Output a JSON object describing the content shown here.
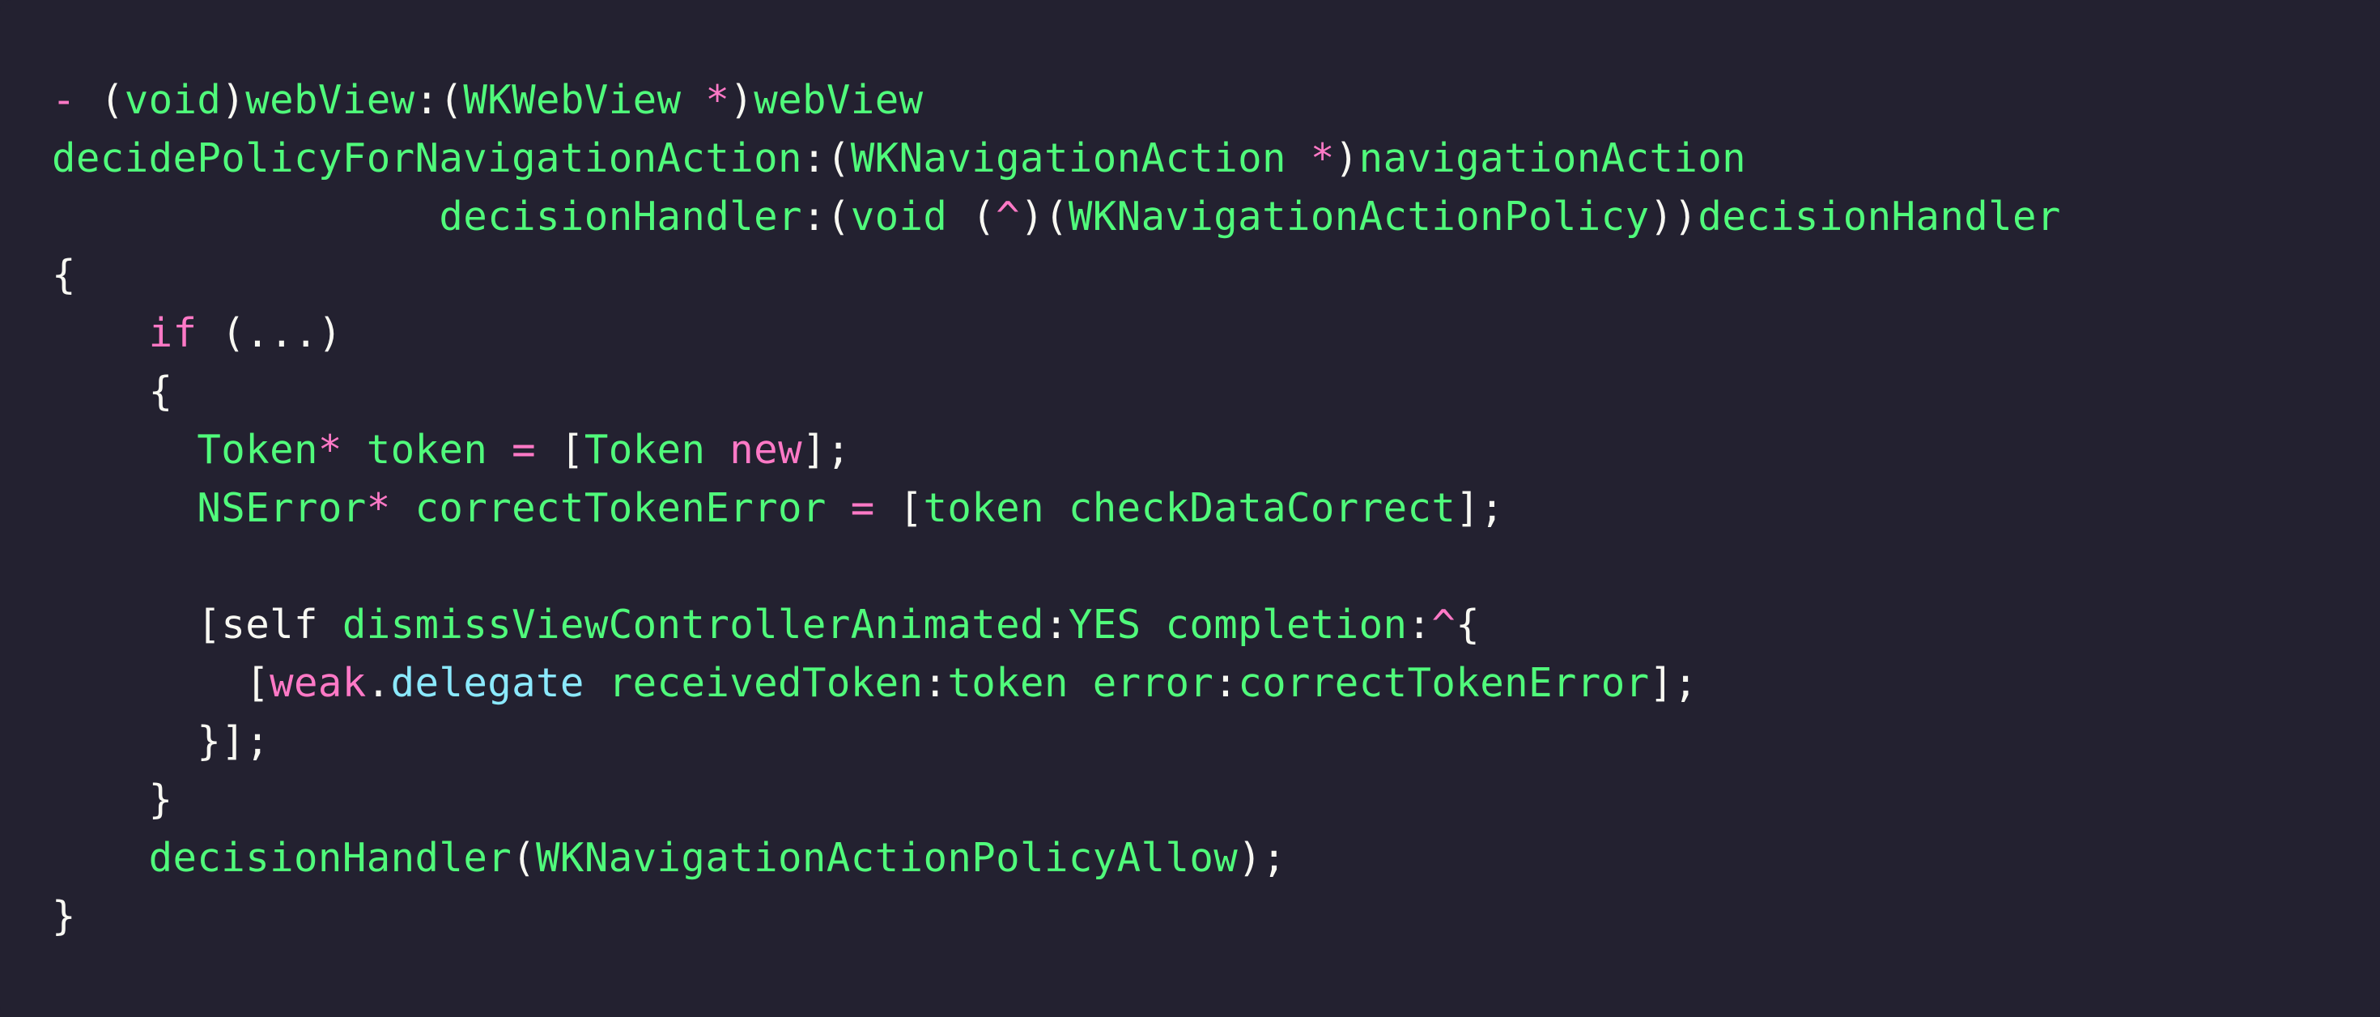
{
  "theme": {
    "background": "#232130",
    "keyword": "#ff79c6",
    "identifier": "#50fa7b",
    "property": "#8be9fd",
    "punctuation": "#f8f8f2"
  },
  "code": {
    "lines": [
      [
        {
          "text": "-",
          "kind": "pink"
        },
        {
          "text": " (",
          "kind": "white"
        },
        {
          "text": "void",
          "kind": "green"
        },
        {
          "text": ")",
          "kind": "white"
        },
        {
          "text": "webView",
          "kind": "green"
        },
        {
          "text": ":(",
          "kind": "white"
        },
        {
          "text": "WKWebView",
          "kind": "green"
        },
        {
          "text": " *",
          "kind": "pink"
        },
        {
          "text": ")",
          "kind": "white"
        },
        {
          "text": "webView",
          "kind": "green"
        }
      ],
      [
        {
          "text": "decidePolicyForNavigationAction",
          "kind": "green"
        },
        {
          "text": ":(",
          "kind": "white"
        },
        {
          "text": "WKNavigationAction",
          "kind": "green"
        },
        {
          "text": " *",
          "kind": "pink"
        },
        {
          "text": ")",
          "kind": "white"
        },
        {
          "text": "navigationAction",
          "kind": "green"
        }
      ],
      [
        {
          "text": "                decisionHandler",
          "kind": "green"
        },
        {
          "text": ":(",
          "kind": "white"
        },
        {
          "text": "void",
          "kind": "green"
        },
        {
          "text": " (",
          "kind": "white"
        },
        {
          "text": "^",
          "kind": "pink"
        },
        {
          "text": ")(",
          "kind": "white"
        },
        {
          "text": "WKNavigationActionPolicy",
          "kind": "green"
        },
        {
          "text": "))",
          "kind": "white"
        },
        {
          "text": "decisionHandler",
          "kind": "green"
        }
      ],
      [
        {
          "text": "{",
          "kind": "white"
        }
      ],
      [
        {
          "text": "    ",
          "kind": "white"
        },
        {
          "text": "if",
          "kind": "pink"
        },
        {
          "text": " (...)",
          "kind": "white"
        }
      ],
      [
        {
          "text": "    {",
          "kind": "white"
        }
      ],
      [
        {
          "text": "      ",
          "kind": "white"
        },
        {
          "text": "Token",
          "kind": "green"
        },
        {
          "text": "*",
          "kind": "pink"
        },
        {
          "text": " token",
          "kind": "green"
        },
        {
          "text": " =",
          "kind": "pink"
        },
        {
          "text": " [",
          "kind": "white"
        },
        {
          "text": "Token",
          "kind": "green"
        },
        {
          "text": " new",
          "kind": "pink"
        },
        {
          "text": "];",
          "kind": "white"
        }
      ],
      [
        {
          "text": "      ",
          "kind": "white"
        },
        {
          "text": "NSError",
          "kind": "green"
        },
        {
          "text": "*",
          "kind": "pink"
        },
        {
          "text": " correctTokenError",
          "kind": "green"
        },
        {
          "text": " =",
          "kind": "pink"
        },
        {
          "text": " [",
          "kind": "white"
        },
        {
          "text": "token",
          "kind": "green"
        },
        {
          "text": " checkDataCorrect",
          "kind": "green"
        },
        {
          "text": "];",
          "kind": "white"
        }
      ],
      [
        {
          "text": "",
          "kind": "white"
        }
      ],
      [
        {
          "text": "      [",
          "kind": "white"
        },
        {
          "text": "self",
          "kind": "white"
        },
        {
          "text": " dismissViewControllerAnimated",
          "kind": "green"
        },
        {
          "text": ":",
          "kind": "white"
        },
        {
          "text": "YES",
          "kind": "green"
        },
        {
          "text": " completion",
          "kind": "green"
        },
        {
          "text": ":",
          "kind": "white"
        },
        {
          "text": "^",
          "kind": "pink"
        },
        {
          "text": "{",
          "kind": "white"
        }
      ],
      [
        {
          "text": "        [",
          "kind": "white"
        },
        {
          "text": "weak",
          "kind": "pink"
        },
        {
          "text": ".",
          "kind": "white"
        },
        {
          "text": "delegate",
          "kind": "cyan"
        },
        {
          "text": " receivedToken",
          "kind": "green"
        },
        {
          "text": ":",
          "kind": "white"
        },
        {
          "text": "token",
          "kind": "green"
        },
        {
          "text": " error",
          "kind": "green"
        },
        {
          "text": ":",
          "kind": "white"
        },
        {
          "text": "correctTokenError",
          "kind": "green"
        },
        {
          "text": "];",
          "kind": "white"
        }
      ],
      [
        {
          "text": "      }];",
          "kind": "white"
        }
      ],
      [
        {
          "text": "    }",
          "kind": "white"
        }
      ],
      [
        {
          "text": "    ",
          "kind": "white"
        },
        {
          "text": "decisionHandler",
          "kind": "green"
        },
        {
          "text": "(",
          "kind": "white"
        },
        {
          "text": "WKNavigationActionPolicyAllow",
          "kind": "green"
        },
        {
          "text": ");",
          "kind": "white"
        }
      ],
      [
        {
          "text": "}",
          "kind": "white"
        }
      ]
    ]
  }
}
